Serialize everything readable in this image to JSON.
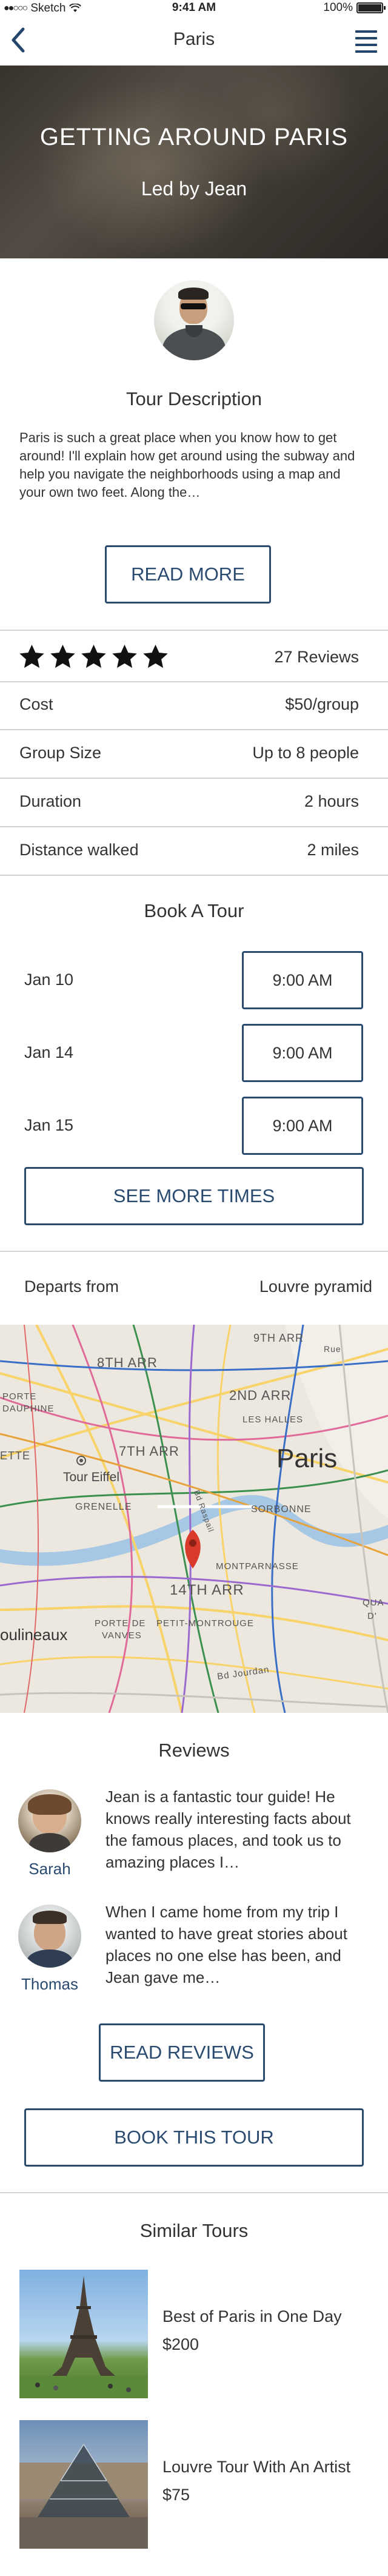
{
  "status_bar": {
    "carrier": "Sketch",
    "time": "9:41 AM",
    "battery": "100%"
  },
  "nav": {
    "title": "Paris"
  },
  "hero": {
    "title": "GETTING AROUND PARIS",
    "subtitle": "Led by Jean"
  },
  "description": {
    "heading": "Tour Description",
    "text": "Paris is such a great place when you know how to get around! I'll explain how get around using the subway and help you navigate the neighborhoods using a map and your own two feet. Along the…",
    "read_more": "READ MORE"
  },
  "rating": {
    "stars": 5,
    "reviews_label": "27 Reviews"
  },
  "details": [
    {
      "label": "Cost",
      "value": "$50/group"
    },
    {
      "label": "Group Size",
      "value": "Up to 8 people"
    },
    {
      "label": "Duration",
      "value": "2 hours"
    },
    {
      "label": "Distance walked",
      "value": "2 miles"
    }
  ],
  "booking": {
    "heading": "Book A Tour",
    "slots": [
      {
        "date": "Jan 10",
        "time": "9:00 AM"
      },
      {
        "date": "Jan 14",
        "time": "9:00 AM"
      },
      {
        "date": "Jan 15",
        "time": "9:00 AM"
      }
    ],
    "see_more": "SEE MORE TIMES"
  },
  "departure": {
    "label": "Departs from",
    "value": "Louvre pyramid"
  },
  "map": {
    "labels": {
      "arr9": "9TH ARR",
      "arr8": "8TH ARR",
      "arr2": "2ND ARR",
      "porte": "PORTE",
      "dauphine": "DAUPHINE",
      "leshalles": "LES HALLES",
      "arr7": "7TH ARR",
      "ette": "ETTE",
      "paris": "Paris",
      "toureiffel": "Tour Eiffel",
      "grenelle": "GRENELLE",
      "sorbonne": "SORBONNE",
      "montparnasse": "MONTPARNASSE",
      "arr14": "14TH ARR",
      "porte2": "PORTE DE",
      "vanves": "VANVES",
      "petitmontrouge": "PETIT-MONTROUGE",
      "moulineaux": "oulineaux",
      "quai": "QUA",
      "ivry": "D'",
      "rue": "Rue",
      "bdjourdan": "Bd Jourdan",
      "bdraspail": "Bd Raspail"
    },
    "pin_color": "#d93a2c"
  },
  "reviews": {
    "heading": "Reviews",
    "items": [
      {
        "name": "Sarah",
        "text": "Jean is a fantastic tour guide! He knows really interesting facts about the famous places, and took us to amazing places I…"
      },
      {
        "name": "Thomas",
        "text": "When I came home from my trip I wanted to have great stories about places no one else has been, and Jean gave me…"
      }
    ],
    "read_reviews": "READ REVIEWS"
  },
  "book_button": "BOOK THIS TOUR",
  "similar": {
    "heading": "Similar Tours",
    "items": [
      {
        "title": "Best of Paris in One Day",
        "price": "$200",
        "icon": "eiffel-tower-photo"
      },
      {
        "title": "Louvre Tour With An Artist",
        "price": "$75",
        "icon": "louvre-pyramid-photo"
      }
    ]
  },
  "colors": {
    "accent": "#2a4a70",
    "divider": "#d4d4d4"
  }
}
